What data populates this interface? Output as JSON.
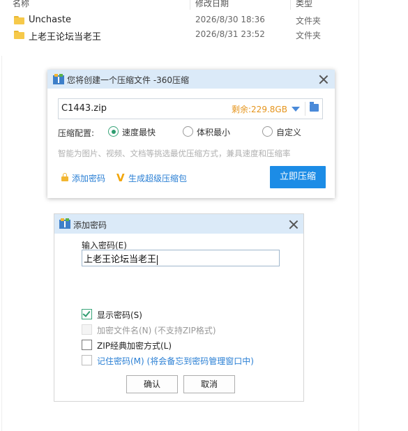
{
  "explorer": {
    "columns": {
      "name": "名称",
      "date": "修改日期",
      "type": "类型"
    },
    "rows": [
      {
        "name": "Unchaste",
        "date": "2026/8/30 18:36",
        "type": "文件夹"
      },
      {
        "name": "上老王论坛当老王",
        "date": "2026/8/31 23:52",
        "type": "文件夹"
      }
    ]
  },
  "zip_dialog": {
    "title": "您将创建一个压缩文件 -360压缩",
    "filename": "C1443.zip",
    "free_space": "剩余:229.8GB",
    "config_label": "压缩配置:",
    "options": [
      {
        "label": "速度最快",
        "selected": true
      },
      {
        "label": "体积最小",
        "selected": false
      },
      {
        "label": "自定义",
        "selected": false
      }
    ],
    "hint": "智能为图片、视频、文档等挑选最优压缩方式，兼具速度和压缩率",
    "add_password": "添加密码",
    "super_zip": "生成超级压缩包",
    "compress_button": "立即压缩",
    "accent_color": "#1c8ce6"
  },
  "password_dialog": {
    "title": "添加密码",
    "input_label": "输入密码(E)",
    "password_value": "上老王论坛当老王",
    "checkboxes": [
      {
        "label": "显示密码(S)",
        "checked": true,
        "enabled": true
      },
      {
        "label": "加密文件名(N) (不支持ZIP格式)",
        "checked": false,
        "enabled": false
      },
      {
        "label": "ZIP经典加密方式(L)",
        "checked": false,
        "enabled": true
      },
      {
        "label": "记住密码(M) (将会备忘到密码管理窗口中)",
        "checked": false,
        "enabled": true
      }
    ],
    "ok_button": "确认",
    "cancel_button": "取消"
  }
}
